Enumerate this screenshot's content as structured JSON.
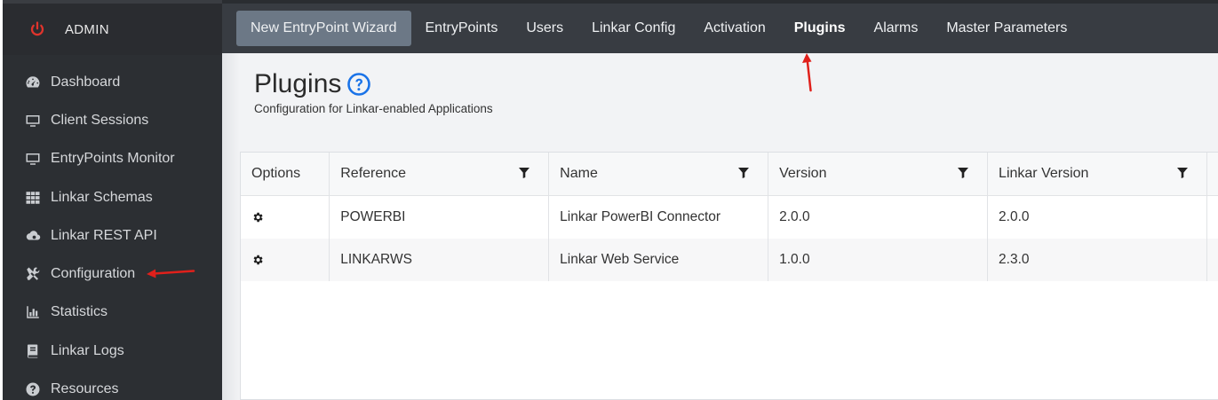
{
  "sidebar": {
    "brand": {
      "label": "ADMIN",
      "icon": "power-icon",
      "icon_color": "#e0342c"
    },
    "items": [
      {
        "label": "Dashboard",
        "icon": "dashboard-gauge-icon"
      },
      {
        "label": "Client Sessions",
        "icon": "monitor-icon"
      },
      {
        "label": "EntryPoints Monitor",
        "icon": "monitor-icon"
      },
      {
        "label": "Linkar Schemas",
        "icon": "grid-icon"
      },
      {
        "label": "Linkar REST API",
        "icon": "cloud-gear-icon"
      },
      {
        "label": "Configuration",
        "icon": "tools-icon"
      },
      {
        "label": "Statistics",
        "icon": "bar-chart-icon"
      },
      {
        "label": "Linkar Logs",
        "icon": "book-icon"
      },
      {
        "label": "Resources",
        "icon": "question-circle-icon"
      }
    ]
  },
  "topnav": {
    "items": [
      {
        "label": "New EntryPoint Wizard"
      },
      {
        "label": "EntryPoints"
      },
      {
        "label": "Users"
      },
      {
        "label": "Linkar Config"
      },
      {
        "label": "Activation"
      },
      {
        "label": "Plugins"
      },
      {
        "label": "Alarms"
      },
      {
        "label": "Master Parameters"
      }
    ],
    "active": "Plugins"
  },
  "page": {
    "title": "Plugins",
    "subtitle": "Configuration for Linkar-enabled Applications",
    "help_icon_color": "#1a73e8"
  },
  "table": {
    "columns": [
      "Options",
      "Reference",
      "Name",
      "Version",
      "Linkar Version"
    ],
    "rows": [
      {
        "reference": "POWERBI",
        "name": "Linkar PowerBI Connector",
        "version": "2.0.0",
        "linkar_version": "2.0.0"
      },
      {
        "reference": "LINKARWS",
        "name": "Linkar Web Service",
        "version": "1.0.0",
        "linkar_version": "2.3.0"
      }
    ]
  },
  "colors": {
    "sidebar_bg": "#2c2f33",
    "topbar_bg": "#383c42",
    "wizard_button_bg": "#6c7886",
    "annotation_arrow": "#e0201b"
  }
}
